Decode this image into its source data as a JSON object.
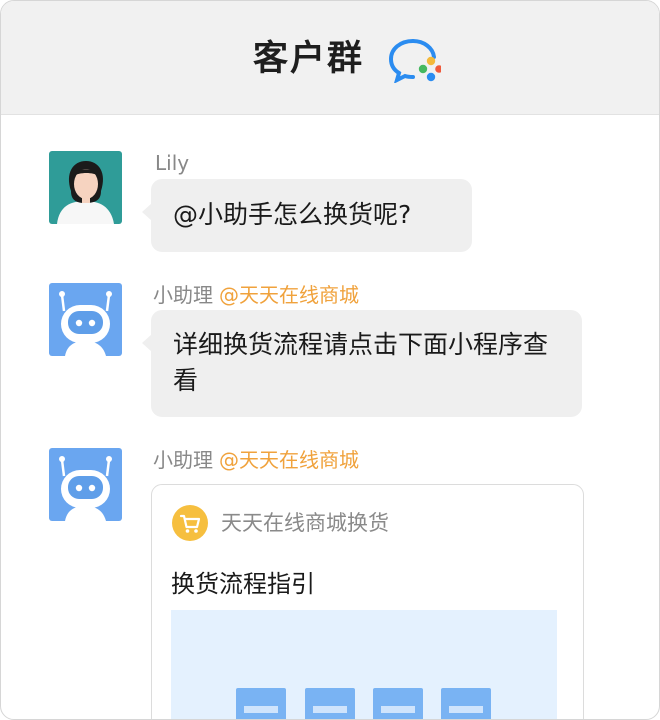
{
  "header": {
    "title": "客户群"
  },
  "messages": [
    {
      "sender": "Lily",
      "text": "@小助手怎么换货呢?"
    },
    {
      "sender": "小助理",
      "org": "@天天在线商城",
      "text": "详细换货流程请点击下面小程序查看"
    },
    {
      "sender": "小助理",
      "org": "@天天在线商城",
      "card": {
        "source": "天天在线商城换货",
        "title": "换货流程指引"
      }
    }
  ],
  "colors": {
    "header_bg": "#f1f1f1",
    "bubble_bg": "#efefef",
    "org_accent": "#f0a23c",
    "bot_avatar": "#6aa6f0"
  }
}
